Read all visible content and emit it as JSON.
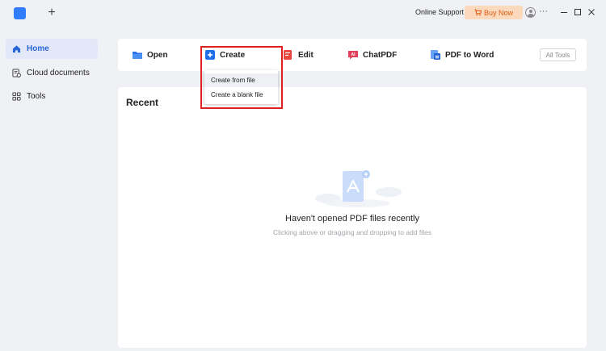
{
  "titlebar": {
    "new_tab_label": "+",
    "online_support": "Online Support",
    "buy_now": "Buy Now",
    "more_label": "···"
  },
  "sidebar": {
    "items": [
      {
        "label": "Home",
        "icon": "home-icon",
        "active": true
      },
      {
        "label": "Cloud documents",
        "icon": "cloud-documents-icon",
        "active": false
      },
      {
        "label": "Tools",
        "icon": "tools-grid-icon",
        "active": false
      }
    ]
  },
  "toolbar": {
    "open": "Open",
    "create": "Create",
    "edit": "Edit",
    "chatpdf": "ChatPDF",
    "pdf_to_word": "PDF to Word",
    "all_tools": "All Tools"
  },
  "create_menu": {
    "items": [
      "Create from file",
      "Create a blank file"
    ]
  },
  "recent": {
    "title": "Recent",
    "empty_title": "Haven't opened PDF files recently",
    "empty_subtitle": "Clicking above or dragging and dropping to add files"
  },
  "colors": {
    "accent": "#2f7dfa",
    "highlight_border": "#e02020",
    "buy_now_bg": "#fbd9bd",
    "buy_now_text": "#e05a14"
  }
}
